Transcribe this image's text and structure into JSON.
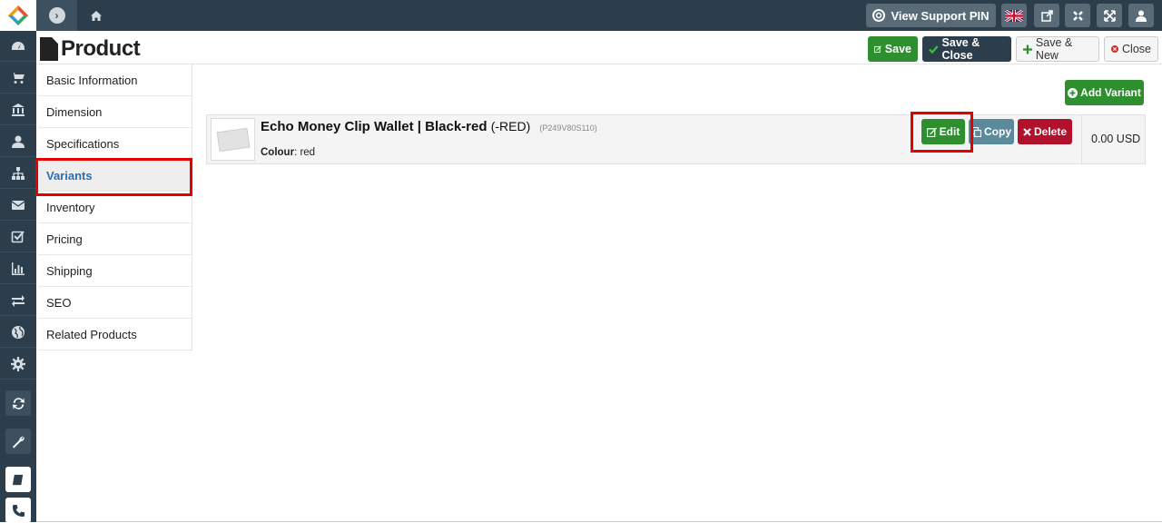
{
  "topbar": {
    "support_label": "View Support PIN",
    "icons": [
      "flag-uk-icon",
      "external-link-icon",
      "joomla-icon",
      "fullscreen-icon",
      "user-icon"
    ]
  },
  "sidebar": {
    "icons": [
      "dashboard-icon",
      "cart-icon",
      "bank-icon",
      "user-icon",
      "sitemap-icon",
      "envelope-icon",
      "check-square-icon",
      "bar-chart-icon",
      "exchange-icon",
      "globe-icon",
      "cog-icon",
      "refresh-icon",
      "wrench-icon",
      "book-icon",
      "phone-icon"
    ]
  },
  "header": {
    "title": "Product",
    "buttons": {
      "save": "Save",
      "save_close": "Save & Close",
      "save_new": "Save & New",
      "close": "Close"
    }
  },
  "tabs": [
    {
      "label": "Basic Information"
    },
    {
      "label": "Dimension"
    },
    {
      "label": "Specifications"
    },
    {
      "label": "Variants",
      "active": true
    },
    {
      "label": "Inventory"
    },
    {
      "label": "Pricing"
    },
    {
      "label": "Shipping"
    },
    {
      "label": "SEO"
    },
    {
      "label": "Related Products"
    }
  ],
  "variants": {
    "add_label": "Add Variant",
    "rows": [
      {
        "name": "Echo Money Clip Wallet | Black-red",
        "suffix": "(-RED)",
        "sku": "(P249V80S110)",
        "attr_label": "Colour",
        "attr_value": ": red",
        "price": "0.00 USD",
        "edit_label": "Edit",
        "copy_label": "Copy",
        "delete_label": "Delete"
      }
    ]
  },
  "colors": {
    "navbar": "#2c3e4c",
    "success": "#2d8f2d",
    "danger": "#b0122b",
    "info": "#5c8a9d",
    "active_tab": "#2a6db5",
    "highlight": "#e50000"
  }
}
